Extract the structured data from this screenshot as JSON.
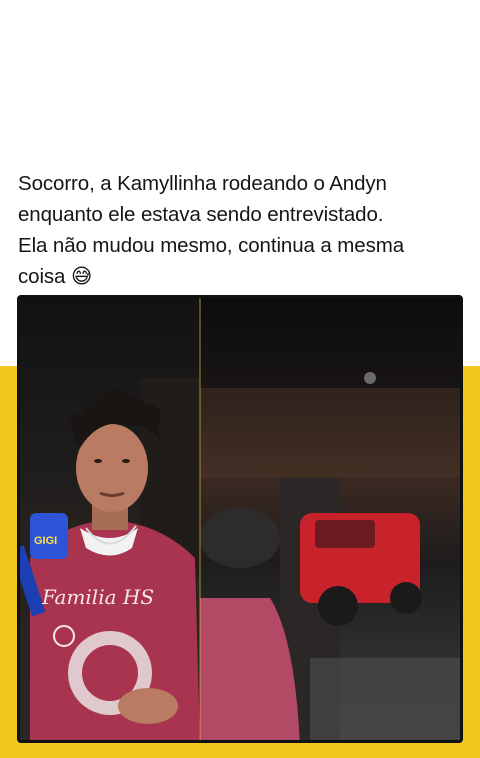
{
  "post": {
    "caption_line1": "Socorro, a Kamyllinha rodeando o Andyn",
    "caption_line2": "enquanto ele estava sendo entrevistado.",
    "caption_line3": "Ela não mudou mesmo, continua a mesma",
    "caption_line4": "coisa",
    "caption_emoji": "😅"
  },
  "video": {
    "mic_logo_text": "GIGI",
    "shirt_text": "Familia HS"
  },
  "colors": {
    "band": "#f2c81e",
    "shirt": "#a8344f",
    "car": "#c8232b",
    "mic": "#2d54d6"
  }
}
